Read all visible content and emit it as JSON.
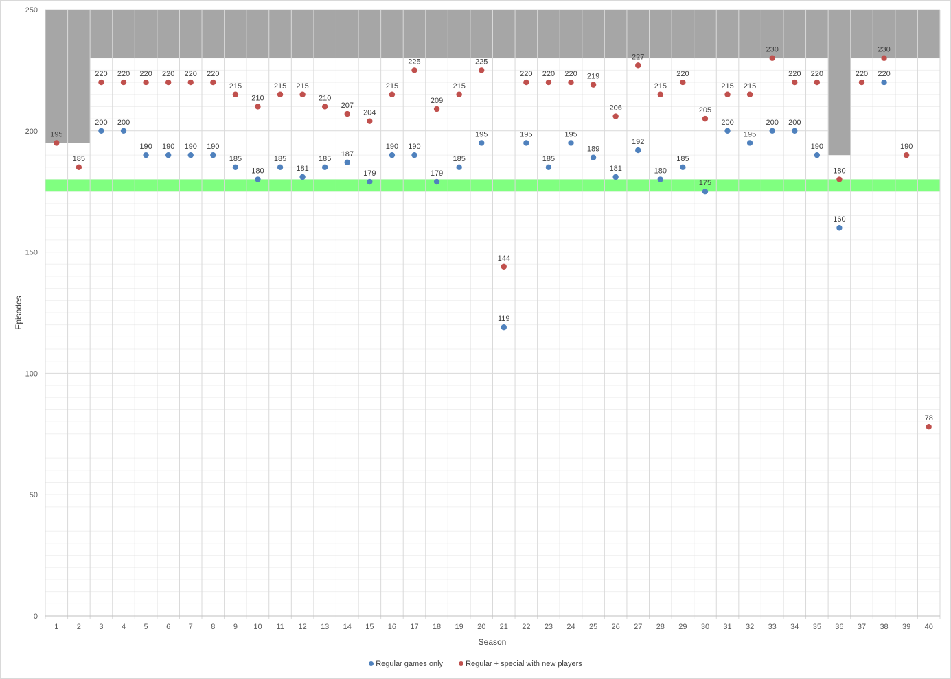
{
  "chart_data": {
    "type": "scatter",
    "xlabel": "Season",
    "ylabel": "Episodes",
    "ylim": [
      0,
      250
    ],
    "yticks": [
      0,
      50,
      100,
      150,
      200,
      250
    ],
    "categories": [
      "1",
      "2",
      "3",
      "4",
      "5",
      "6",
      "7",
      "8",
      "9",
      "10",
      "11",
      "12",
      "13",
      "14",
      "15",
      "16",
      "17",
      "18",
      "19",
      "20",
      "21",
      "22",
      "23",
      "24",
      "25",
      "26",
      "27",
      "28",
      "29",
      "30",
      "31",
      "32",
      "33",
      "34",
      "35",
      "36",
      "37",
      "38",
      "39",
      "40"
    ],
    "series": [
      {
        "name": "Regular games only",
        "color": "#4f81bd",
        "values": [
          null,
          null,
          200,
          200,
          190,
          190,
          190,
          190,
          185,
          180,
          185,
          181,
          185,
          187,
          179,
          190,
          190,
          179,
          185,
          195,
          119,
          195,
          185,
          195,
          189,
          181,
          192,
          180,
          185,
          175,
          200,
          195,
          200,
          200,
          190,
          160,
          null,
          220,
          null,
          null
        ]
      },
      {
        "name": "Regular + special with new players",
        "color": "#c0504d",
        "values": [
          195,
          185,
          220,
          220,
          220,
          220,
          220,
          220,
          215,
          210,
          215,
          215,
          210,
          207,
          204,
          215,
          225,
          209,
          215,
          225,
          144,
          220,
          220,
          220,
          219,
          206,
          227,
          215,
          220,
          205,
          215,
          215,
          230,
          220,
          220,
          180,
          220,
          230,
          190,
          78
        ]
      }
    ],
    "background_band_top": [
      195,
      195,
      230,
      230,
      230,
      230,
      230,
      230,
      230,
      230,
      230,
      230,
      230,
      230,
      230,
      230,
      230,
      230,
      230,
      230,
      230,
      230,
      230,
      230,
      230,
      230,
      230,
      230,
      230,
      230,
      230,
      230,
      230,
      230,
      230,
      190,
      230,
      230,
      230,
      230
    ],
    "band_color": "#a6a6a6",
    "highlight_band": {
      "from": 175,
      "to": 180,
      "color": "#80ff80"
    },
    "grid": true,
    "legend_position": "bottom"
  }
}
